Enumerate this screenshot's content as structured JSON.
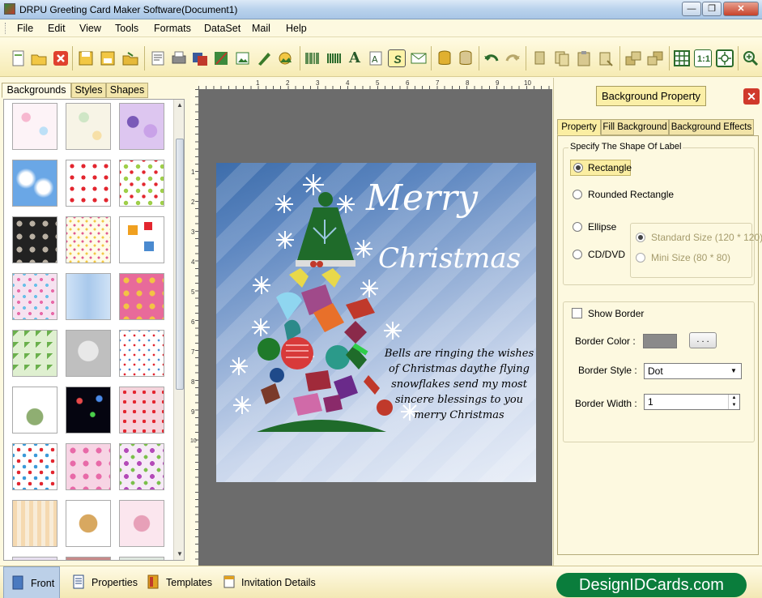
{
  "window": {
    "title": "DRPU Greeting Card Maker Software(Document1)",
    "minimize": "—",
    "maximize": "❐",
    "close": "✕"
  },
  "menu": [
    "File",
    "Edit",
    "View",
    "Tools",
    "Formats",
    "DataSet",
    "Mail",
    "Help"
  ],
  "toolbar": {
    "icons": [
      "new-icon",
      "open-icon",
      "close-doc-icon",
      "save-icon",
      "save-as-icon",
      "open-folder-icon",
      "print-preview-icon",
      "print-icon",
      "copy-format-icon",
      "shapes-icon",
      "image-icon",
      "pencil-icon",
      "picture-icon",
      "barcode-icon",
      "watermark-icon",
      "text-icon",
      "document-text-icon",
      "signature-icon",
      "mail-icon",
      "database-icon",
      "database-2-icon",
      "undo-icon",
      "redo-icon",
      "cut-icon",
      "copy-icon",
      "paste-icon",
      "delete-icon",
      "bring-front-icon",
      "send-back-icon",
      "grid-icon",
      "actual-size-icon",
      "fit-window-icon",
      "zoom-in-icon"
    ]
  },
  "left_panel": {
    "tabs": [
      "Backgrounds",
      "Styles",
      "Shapes"
    ],
    "active_tab": "Backgrounds"
  },
  "card": {
    "title_line1": "Merry",
    "title_line2": "Christmas",
    "message": "Bells are ringing the wishes of Christmas daythe flying snowflakes send my most sincere blessings to you merry Christmas"
  },
  "right_panel": {
    "header_button": "Background Property",
    "close_icon": "✕",
    "tabs": [
      "Property",
      "Fill Background",
      "Background Effects"
    ],
    "active_tab": "Property",
    "shape_group_label": "Specify The Shape Of Label",
    "shapes": {
      "rectangle": "Rectangle",
      "rounded_rectangle": "Rounded Rectangle",
      "ellipse": "Ellipse",
      "cd_dvd": "CD/DVD"
    },
    "selected_shape": "Rectangle",
    "cd_sizes": {
      "standard": "Standard Size (120 * 120)",
      "mini": "Mini Size (80 * 80)"
    },
    "show_border": "Show Border",
    "border_color_label": "Border Color :",
    "border_color": "#8a8a8a",
    "color_button": ". . .",
    "border_style_label": "Border Style :",
    "border_style_value": "Dot",
    "border_width_label": "Border Width :",
    "border_width_value": "1"
  },
  "bottom_bar": {
    "items": [
      "Front",
      "Properties",
      "Templates",
      "Invitation Details"
    ],
    "active": "Front",
    "brand": "DesignIDCards.com"
  },
  "ruler": {
    "top_marks": [
      "1",
      "2",
      "3",
      "4",
      "5",
      "6",
      "7",
      "8",
      "9",
      "10"
    ],
    "left_marks": [
      "1",
      "2",
      "3",
      "4",
      "5",
      "6",
      "7",
      "8",
      "9",
      "10"
    ]
  }
}
